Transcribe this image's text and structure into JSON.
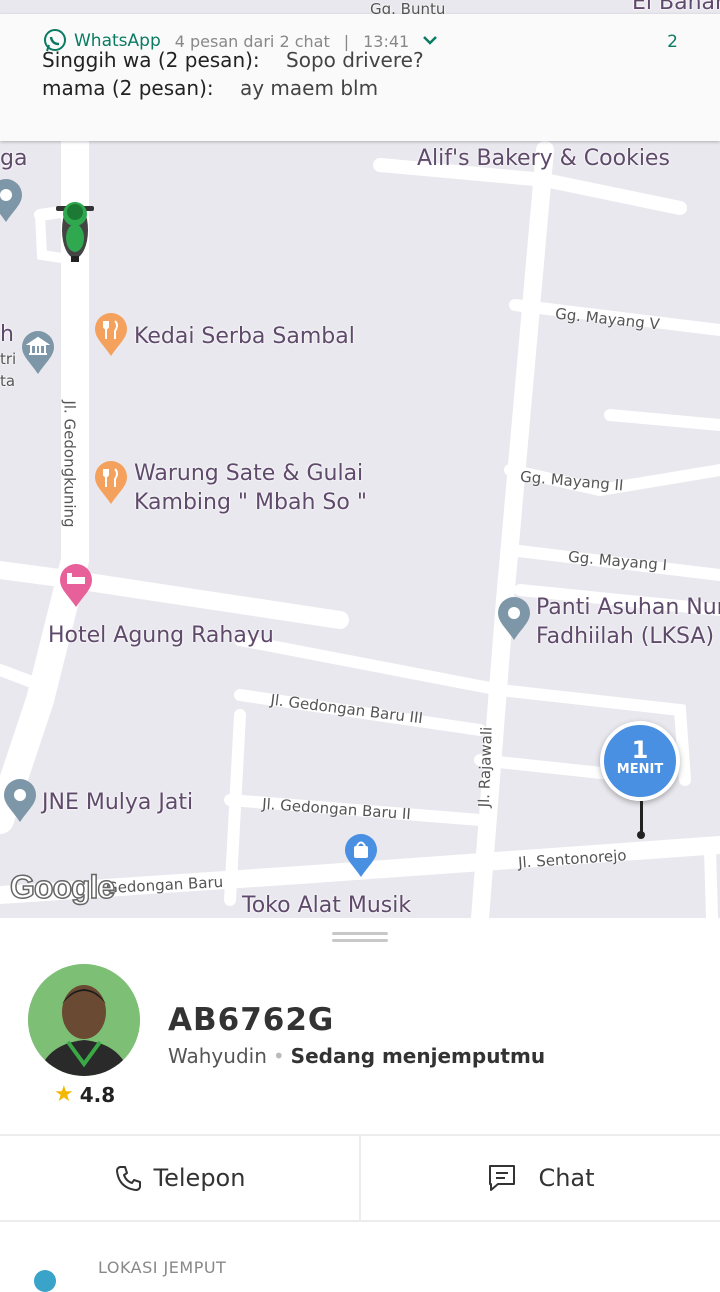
{
  "notification": {
    "app": "WhatsApp",
    "summary": "4 pesan dari 2 chat",
    "separator": "|",
    "time": "13:41",
    "count": "2",
    "messages": [
      {
        "sender": "Singgih wa (2 pesan):",
        "text": "Sopo drivere?"
      },
      {
        "sender": "mama (2 pesan):",
        "text": "ay maem blm"
      }
    ]
  },
  "map": {
    "pois": [
      "Alif's Bakery & Cookies",
      "Kedai Serba Sambal",
      "Warung Sate & Gulai",
      "Kambing \" Mbah So \"",
      "Hotel Agung Rahayu",
      "Panti Asuhan Nur",
      "Fadhiilah (LKSA)",
      "JNE Mulya Jati",
      "Toko Alat Musik"
    ],
    "streets": [
      "Gg. Buntu",
      "El Bahar",
      "ga",
      "Gg. Mayang V",
      "Gg. Mayang II",
      "Gg. Mayang I",
      "Jl. Gedongkuning",
      "Jl. Gedongan Baru III",
      "Jl. Gedongan Baru II",
      "Jl. Rajawali",
      "Jl. Sentonorejo",
      "Gedongan Baru",
      "h",
      "tri",
      "ta"
    ],
    "eta_value": "1",
    "eta_unit": "MENIT",
    "attribution": "Google"
  },
  "driver": {
    "plate": "AB6762G",
    "name": "Wahyudin",
    "status": "Sedang menjemputmu",
    "rating": "4.8"
  },
  "actions": {
    "call_label": "Telepon",
    "chat_label": "Chat"
  },
  "pickup": {
    "label": "LOKASI JEMPUT"
  },
  "colors": {
    "whatsapp_green": "#0b7a63",
    "eta_blue": "#4a90e2",
    "map_bg": "#e9e8ee",
    "poi_orange": "#f4a15d",
    "poi_pink": "#e8609a",
    "poi_blue": "#4a90e2",
    "poi_gray": "#7e97a8"
  }
}
